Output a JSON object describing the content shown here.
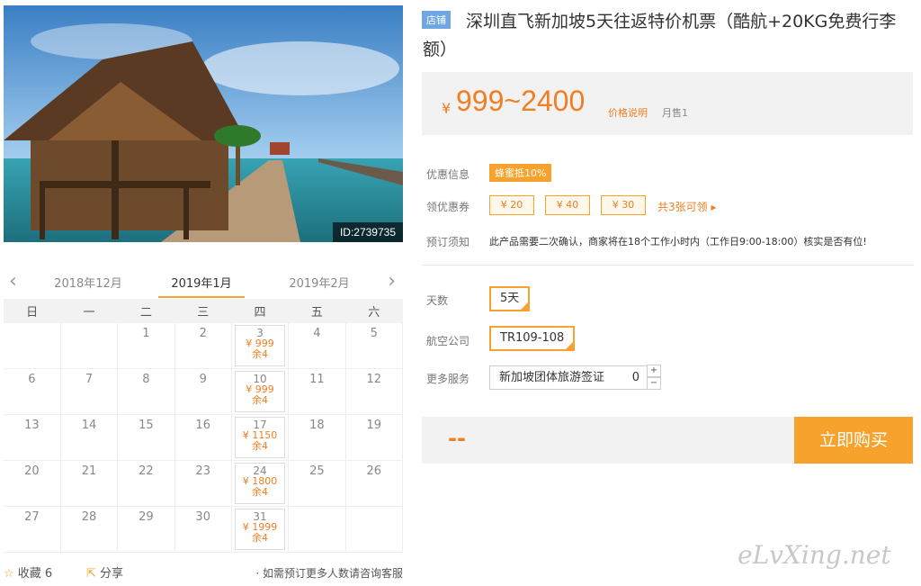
{
  "hero": {
    "id_text": "ID:2739735"
  },
  "calendar": {
    "prev_month": "2018年12月",
    "current_month": "2019年1月",
    "next_month": "2019年2月",
    "weekdays": [
      "日",
      "一",
      "二",
      "三",
      "四",
      "五",
      "六"
    ],
    "weeks": [
      [
        {
          "d": ""
        },
        {
          "d": ""
        },
        {
          "d": "1"
        },
        {
          "d": "2"
        },
        {
          "d": "3",
          "price": "¥ 999",
          "stock": "余4"
        },
        {
          "d": "4"
        },
        {
          "d": "5"
        }
      ],
      [
        {
          "d": "6"
        },
        {
          "d": "7"
        },
        {
          "d": "8"
        },
        {
          "d": "9"
        },
        {
          "d": "10",
          "price": "¥ 999",
          "stock": "余4"
        },
        {
          "d": "11"
        },
        {
          "d": "12"
        }
      ],
      [
        {
          "d": "13"
        },
        {
          "d": "14"
        },
        {
          "d": "15"
        },
        {
          "d": "16"
        },
        {
          "d": "17",
          "price": "¥ 1150",
          "stock": "余4"
        },
        {
          "d": "18"
        },
        {
          "d": "19"
        }
      ],
      [
        {
          "d": "20"
        },
        {
          "d": "21"
        },
        {
          "d": "22"
        },
        {
          "d": "23"
        },
        {
          "d": "24",
          "price": "¥ 1800",
          "stock": "余4"
        },
        {
          "d": "25"
        },
        {
          "d": "26"
        }
      ],
      [
        {
          "d": "27"
        },
        {
          "d": "28"
        },
        {
          "d": "29"
        },
        {
          "d": "30"
        },
        {
          "d": "31",
          "price": "¥ 1999",
          "stock": "余4"
        },
        {
          "d": ""
        },
        {
          "d": ""
        }
      ]
    ]
  },
  "footer": {
    "favorite": "收藏 6",
    "share": "分享",
    "help": "· 如需预订更多人数请咨询客服"
  },
  "product": {
    "badge": "店铺",
    "title": "深圳直飞新加坡5天往返特价机票（酷航+20KG免费行李额）",
    "currency": "¥",
    "price": "999~2400",
    "price_explain": "价格说明",
    "monthly_sales": "月售1"
  },
  "info": {
    "discount_label": "优惠信息",
    "discount_value": "蜂蜜抵10%",
    "coupon_label": "领优惠券",
    "coupons": [
      "¥ 20",
      "¥ 40",
      "¥ 30"
    ],
    "coupon_more": "共3张可领 ▸",
    "notice_label": "预订须知",
    "notice_text": "此产品需要二次确认，商家将在18个工作小时内（工作日9:00-18:00）核实是否有位!"
  },
  "options": {
    "days_label": "天数",
    "days_value": "5天",
    "airline_label": "航空公司",
    "airline_value": "TR109-108",
    "service_label": "更多服务",
    "service_value": "新加坡团体旅游签证",
    "service_qty": "0"
  },
  "buy": {
    "total": "--",
    "button": "立即购买"
  },
  "watermark": "eLvXing.net",
  "colors": {
    "accent": "#f7a22c",
    "price": "#f07e22",
    "badge": "#6fa7e4"
  }
}
